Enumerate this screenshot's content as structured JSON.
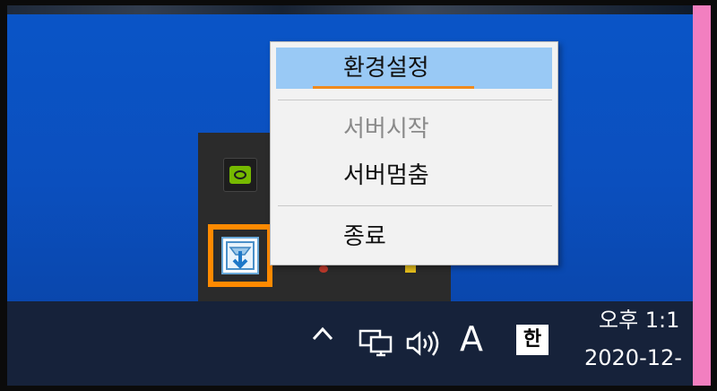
{
  "context_menu": {
    "items": [
      {
        "label": "환경설정",
        "state": "selected"
      },
      {
        "label": "서버시작",
        "state": "disabled"
      },
      {
        "label": "서버멈춤",
        "state": "normal"
      },
      {
        "label": "종료",
        "state": "normal"
      }
    ]
  },
  "tray_flyout": {
    "icons": [
      "nvidia-icon",
      "server-app-icon"
    ]
  },
  "taskbar": {
    "ime_mode_label": "A",
    "ime_lang_label": "한",
    "clock_time": "오후 1:1",
    "clock_date": "2020-12-"
  },
  "colors": {
    "desktop_blue": "#0a55c7",
    "menu_selection": "#99c9f5",
    "highlight_orange": "#ff8a00",
    "taskbar": "#16223a"
  }
}
